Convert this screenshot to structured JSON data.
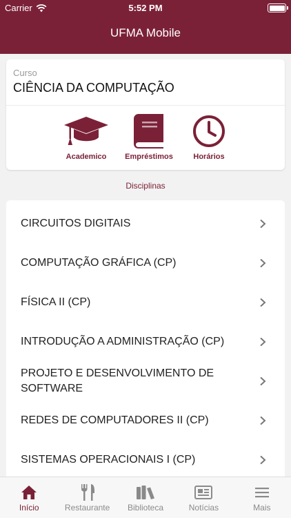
{
  "status_bar": {
    "carrier": "Carrier",
    "time": "5:52 PM"
  },
  "nav": {
    "title": "UFMA Mobile"
  },
  "course": {
    "label": "Curso",
    "name": "CIÊNCIA DA COMPUTAÇÃO"
  },
  "quick_actions": [
    {
      "label": "Academico",
      "icon": "graduation-cap-icon"
    },
    {
      "label": "Empréstimos",
      "icon": "book-icon"
    },
    {
      "label": "Horários",
      "icon": "clock-icon"
    }
  ],
  "disciplinas": {
    "title": "Disciplinas",
    "items": [
      "CIRCUITOS DIGITAIS",
      "COMPUTAÇÃO GRÁFICA  (CP)",
      "FÍSICA II  (CP)",
      "INTRODUÇÃO A ADMINISTRAÇÃO (CP)",
      "PROJETO E DESENVOLVIMENTO DE SOFTWARE",
      "REDES DE COMPUTADORES II  (CP)",
      "SISTEMAS OPERACIONAIS I  (CP)"
    ]
  },
  "tabs": [
    {
      "label": "Início",
      "icon": "home-icon",
      "active": true
    },
    {
      "label": "Restaurante",
      "icon": "fork-knife-icon",
      "active": false
    },
    {
      "label": "Biblioteca",
      "icon": "library-icon",
      "active": false
    },
    {
      "label": "Notícias",
      "icon": "newspaper-icon",
      "active": false
    },
    {
      "label": "Mais",
      "icon": "menu-icon",
      "active": false
    }
  ],
  "colors": {
    "brand": "#7b2137",
    "tab_inactive": "#8a8a8a",
    "background": "#f2f2f2"
  }
}
